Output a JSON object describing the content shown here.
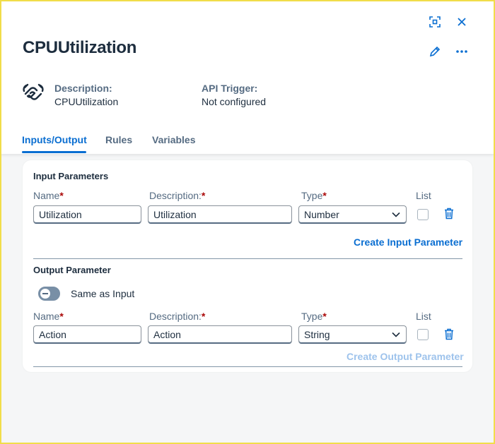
{
  "header": {
    "title": "CPUUtilization",
    "description_label": "Description:",
    "description_value": "CPUUtilization",
    "api_trigger_label": "API Trigger:",
    "api_trigger_value": "Not configured"
  },
  "toolbar_icons": [
    "fullscreen-icon",
    "close-icon",
    "edit-icon",
    "more-icon"
  ],
  "tabs": [
    {
      "label": "Inputs/Output",
      "active": true
    },
    {
      "label": "Rules",
      "active": false
    },
    {
      "label": "Variables",
      "active": false
    }
  ],
  "input_section": {
    "title": "Input Parameters",
    "columns": {
      "name": "Name",
      "description": "Description:",
      "type": "Type",
      "list": "List"
    },
    "rows": [
      {
        "name": "Utilization",
        "description": "Utilization",
        "type": "Number",
        "list": false
      }
    ],
    "create_link": "Create Input Parameter"
  },
  "output_section": {
    "title": "Output Parameter",
    "same_as_input_label": "Same as Input",
    "same_as_input_on": false,
    "columns": {
      "name": "Name",
      "description": "Description:",
      "type": "Type",
      "list": "List"
    },
    "rows": [
      {
        "name": "Action",
        "description": "Action",
        "type": "String",
        "list": false
      }
    ],
    "create_link": "Create Output Parameter"
  },
  "colors": {
    "accent": "#0a6ed1",
    "required": "#aa0808",
    "disabled_link": "#9ec3ec",
    "frame": "#f1dd4a"
  }
}
